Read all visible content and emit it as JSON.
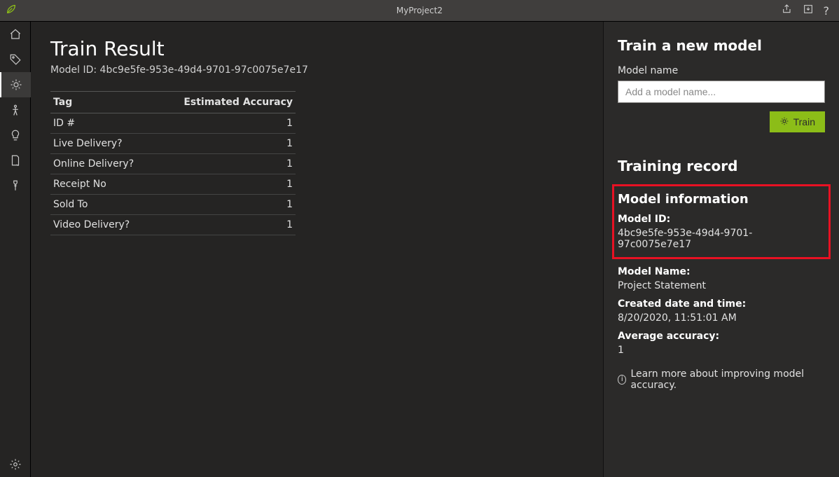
{
  "titlebar": {
    "project_name": "MyProject2"
  },
  "main": {
    "heading": "Train Result",
    "model_id_line": "Model ID: 4bc9e5fe-953e-49d4-9701-97c0075e7e17",
    "table": {
      "col_tag": "Tag",
      "col_acc": "Estimated Accuracy",
      "rows": [
        {
          "tag": "ID #",
          "acc": "1"
        },
        {
          "tag": "Live Delivery?",
          "acc": "1"
        },
        {
          "tag": "Online Delivery?",
          "acc": "1"
        },
        {
          "tag": "Receipt No",
          "acc": "1"
        },
        {
          "tag": "Sold To",
          "acc": "1"
        },
        {
          "tag": "Video Delivery?",
          "acc": "1"
        }
      ]
    }
  },
  "right": {
    "train_heading": "Train a new model",
    "model_name_label": "Model name",
    "model_name_placeholder": "Add a model name...",
    "train_button": "Train",
    "record_heading": "Training record",
    "model_info_heading": "Model information",
    "model_id_label": "Model ID:",
    "model_id_value": "4bc9e5fe-953e-49d4-9701-97c0075e7e17",
    "model_name_label2": "Model Name:",
    "model_name_value": "Project Statement",
    "created_label": "Created date and time:",
    "created_value": "8/20/2020, 11:51:01 AM",
    "avg_acc_label": "Average accuracy:",
    "avg_acc_value": "1",
    "learn_more": "Learn more about improving model accuracy."
  }
}
